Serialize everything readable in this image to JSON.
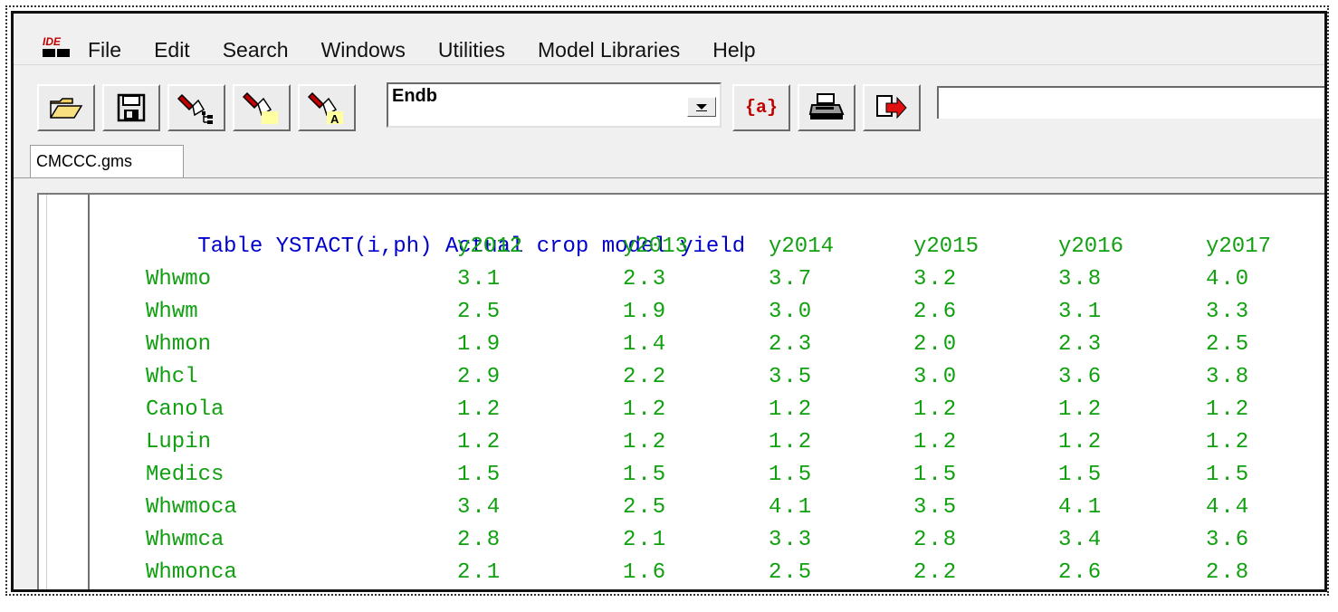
{
  "menu": {
    "icon_text": "IDE",
    "items": [
      "File",
      "Edit",
      "Search",
      "Windows",
      "Utilities",
      "Model Libraries",
      "Help"
    ]
  },
  "toolbar": {
    "buttons": [
      {
        "name": "open-folder-icon"
      },
      {
        "name": "save-disk-icon"
      },
      {
        "name": "flashlight-tree-icon"
      },
      {
        "name": "flashlight-icon"
      },
      {
        "name": "flashlight-a-icon"
      }
    ],
    "combo_value": "Endb",
    "after_buttons": [
      {
        "name": "at-a-button",
        "label": "{a}"
      },
      {
        "name": "printer-icon"
      },
      {
        "name": "export-arrow-icon"
      }
    ],
    "search_value": ""
  },
  "tab": {
    "label": "CMCCC.gms"
  },
  "editor": {
    "table_keyword": "Table",
    "table_name": "YSTACT(i,ph)",
    "table_desc": "Actual crop model yield",
    "columns": [
      "y2012",
      "y2013",
      "y2014",
      "y2015",
      "y2016",
      "y2017"
    ],
    "rows": [
      {
        "label": "Whwmo",
        "values": [
          "3.1",
          "2.3",
          "3.7",
          "3.2",
          "3.8",
          "4.0"
        ]
      },
      {
        "label": "Whwm",
        "values": [
          "2.5",
          "1.9",
          "3.0",
          "2.6",
          "3.1",
          "3.3"
        ]
      },
      {
        "label": "Whmon",
        "values": [
          "1.9",
          "1.4",
          "2.3",
          "2.0",
          "2.3",
          "2.5"
        ]
      },
      {
        "label": "Whcl",
        "values": [
          "2.9",
          "2.2",
          "3.5",
          "3.0",
          "3.6",
          "3.8"
        ]
      },
      {
        "label": "Canola",
        "values": [
          "1.2",
          "1.2",
          "1.2",
          "1.2",
          "1.2",
          "1.2"
        ]
      },
      {
        "label": "Lupin",
        "values": [
          "1.2",
          "1.2",
          "1.2",
          "1.2",
          "1.2",
          "1.2"
        ]
      },
      {
        "label": "Medics",
        "values": [
          "1.5",
          "1.5",
          "1.5",
          "1.5",
          "1.5",
          "1.5"
        ]
      },
      {
        "label": "Whwmoca",
        "values": [
          "3.4",
          "2.5",
          "4.1",
          "3.5",
          "4.1",
          "4.4"
        ]
      },
      {
        "label": "Whwmca",
        "values": [
          "2.8",
          "2.1",
          "3.3",
          "2.8",
          "3.4",
          "3.6"
        ]
      },
      {
        "label": "Whmonca",
        "values": [
          "2.1",
          "1.6",
          "2.5",
          "2.2",
          "2.6",
          "2.8"
        ]
      }
    ]
  },
  "colors": {
    "keyword": "#0000cc",
    "data": "#10a010"
  }
}
